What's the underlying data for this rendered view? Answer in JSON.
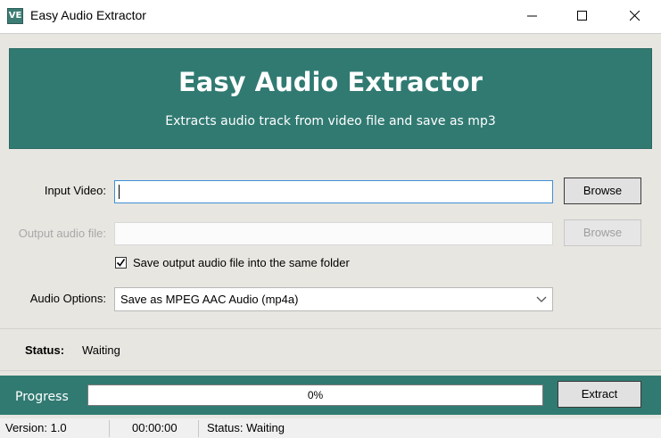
{
  "window": {
    "title": "Easy Audio Extractor",
    "icon": "app-logo-icon",
    "icon_text": "VE"
  },
  "header": {
    "title": "Easy Audio Extractor",
    "subtitle": "Extracts audio track from video file and save as mp3",
    "color": "#317a72"
  },
  "form": {
    "input_video_label": "Input Video:",
    "input_video_value": "",
    "input_browse_label": "Browse",
    "output_label": "Output audio file:",
    "output_value": "",
    "output_browse_label": "Browse",
    "same_folder_label": "Save output audio file into the same folder",
    "same_folder_checked": true,
    "audio_options_label": "Audio Options:",
    "audio_options_selected": "Save as MPEG AAC Audio (mp4a)"
  },
  "status": {
    "key": "Status:",
    "value": "Waiting"
  },
  "progress": {
    "label": "Progress",
    "percent": 0,
    "text": "0%",
    "extract_label": "Extract"
  },
  "statusbar": {
    "version": "Version: 1.0",
    "time": "00:00:00",
    "status": "Status: Waiting"
  }
}
